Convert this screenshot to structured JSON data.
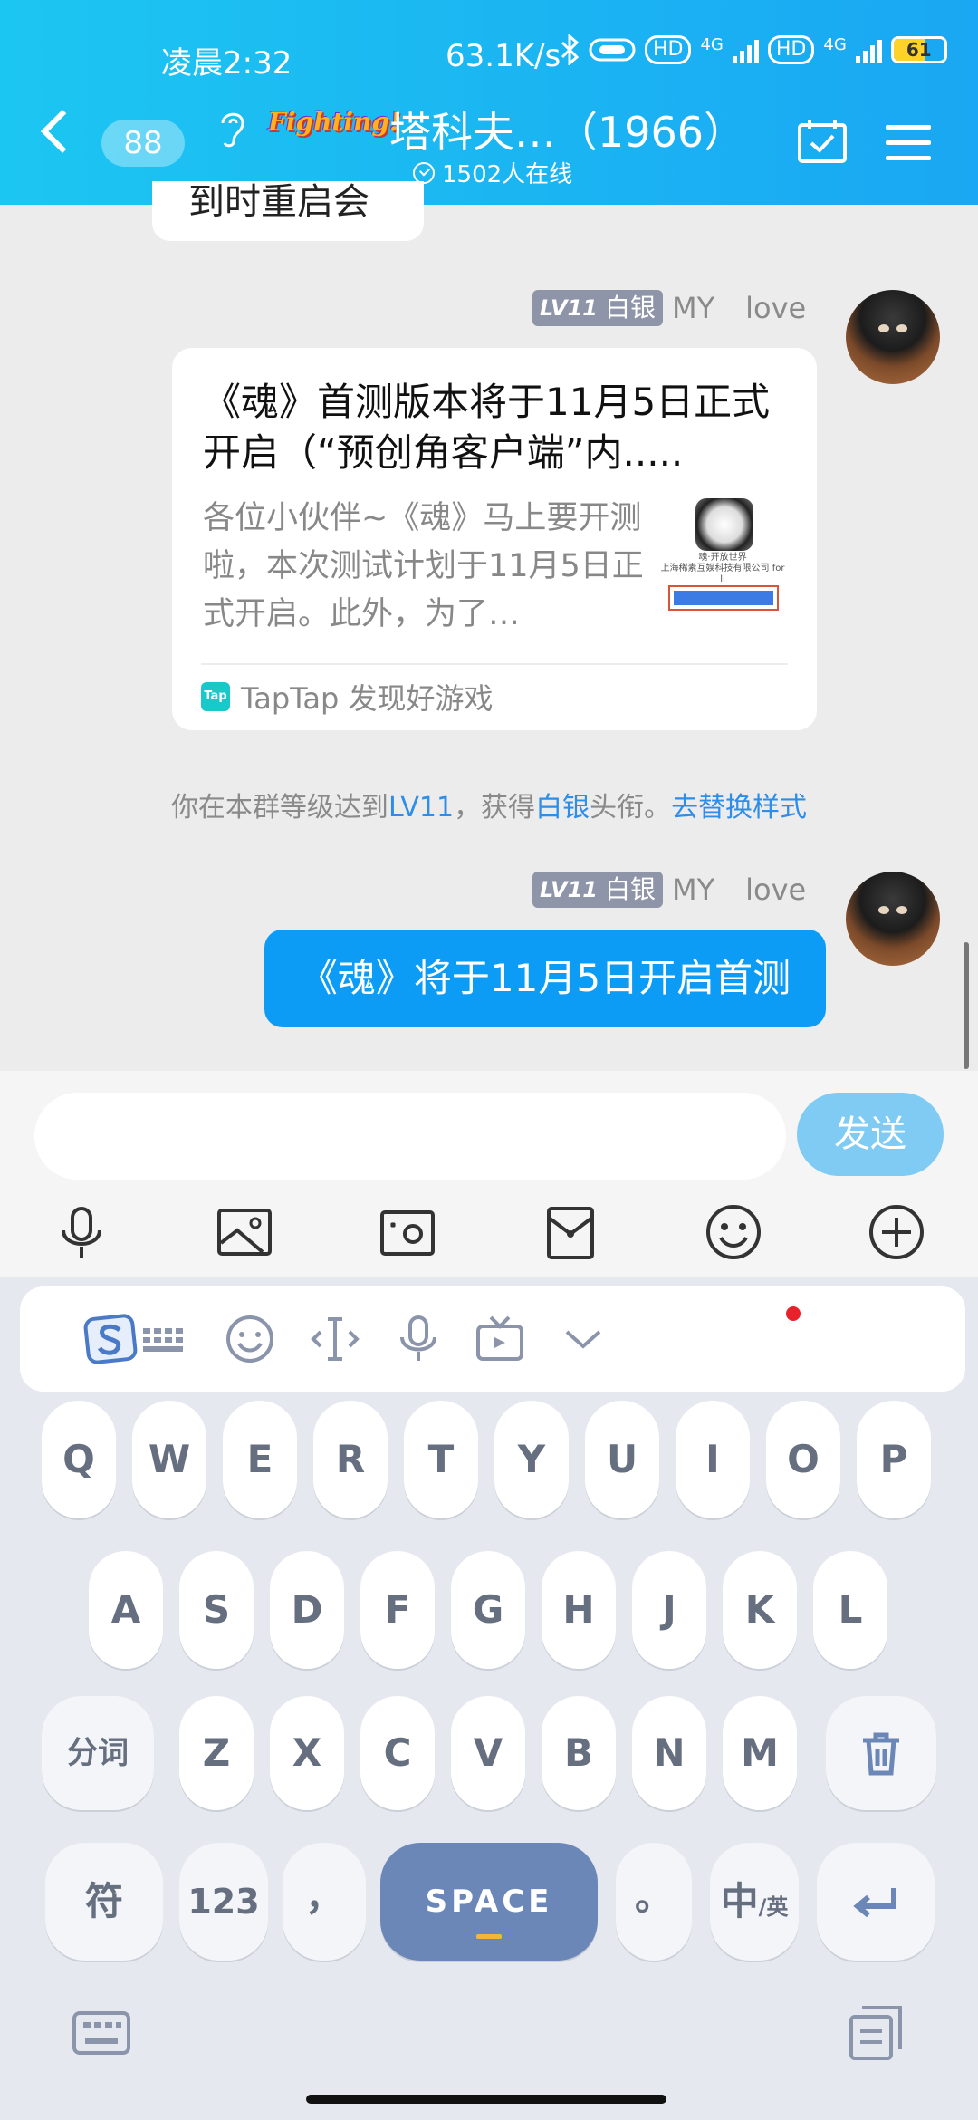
{
  "status_bar": {
    "time": "凌晨2:32",
    "net_speed": "63.1K/s",
    "hd1": "HD",
    "net1": "4G",
    "hd2": "HD",
    "net2": "4G",
    "battery": "61",
    "battery_level": 0.61
  },
  "header": {
    "unread_count": "88",
    "group_logo_text": "Fighting!",
    "group_title": "塔科夫…（1966）",
    "online_count": "1502人在线"
  },
  "chat": {
    "previous_partial_text": "到时重启会",
    "messages": [
      {
        "level": "LV11",
        "rank": "白银",
        "name": "MY",
        "suffix": "love",
        "card": {
          "title": "《魂》首测版本将于11月5日正式开启（“预创角客户端”内.....",
          "desc": "各位小伙伴~《魂》马上要开测啦，本次测试计划于11月5日正式开启。此外，为了…",
          "thumb_text": "魂·开放世界\n上海稀素互娱科技有限公司 for li",
          "source_icon": "Tap",
          "source": "TapTap 发现好游戏"
        }
      },
      {
        "level": "LV11",
        "rank": "白银",
        "name": "MY",
        "suffix": "love",
        "text": "《魂》将于11月5日开启首测"
      }
    ],
    "system": {
      "prefix": "你在本群等级达到",
      "level": "LV11",
      "mid": "，获得",
      "rank": "白银",
      "suffix": "头衔。",
      "action": "去替换样式"
    }
  },
  "input": {
    "placeholder": "",
    "send_label": "发送"
  },
  "keyboard": {
    "row1": [
      "Q",
      "W",
      "E",
      "R",
      "T",
      "Y",
      "U",
      "I",
      "O",
      "P"
    ],
    "row2": [
      "A",
      "S",
      "D",
      "F",
      "G",
      "H",
      "J",
      "K",
      "L"
    ],
    "row3_left": "分词",
    "row3": [
      "Z",
      "X",
      "C",
      "V",
      "B",
      "N",
      "M"
    ],
    "symbol": "符",
    "num": "123",
    "comma": "，",
    "space": "SPACE",
    "period": "。",
    "lang": "中",
    "lang_sub": "/英"
  }
}
